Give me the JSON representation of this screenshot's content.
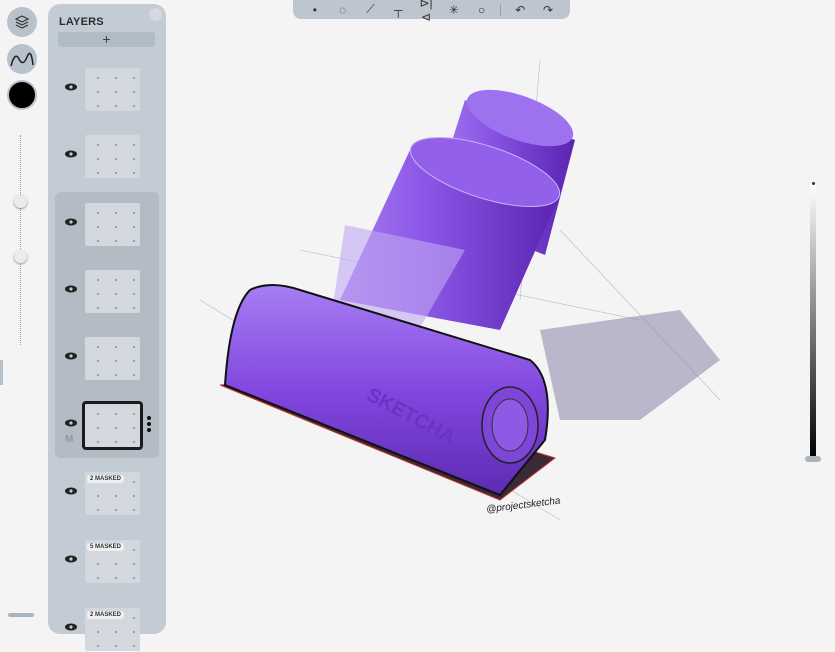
{
  "layers_panel": {
    "title": "LAYERS",
    "add_label": "+",
    "layers": [
      {
        "visible": true
      },
      {
        "visible": true
      },
      {
        "visible": true
      },
      {
        "visible": true
      },
      {
        "visible": true
      },
      {
        "visible": true,
        "selected": true,
        "mode_label": "M"
      },
      {
        "visible": true,
        "badge": "2 MASKED"
      },
      {
        "visible": true,
        "badge": "5 MASKED"
      },
      {
        "visible": true,
        "badge": "2 MASKED"
      }
    ]
  },
  "toolbar": {
    "icons": [
      "dot-icon",
      "lasso-icon",
      "curve-icon",
      "perspective-icon",
      "symmetry-icon",
      "radial-icon",
      "rotate-icon",
      "undo-icon",
      "redo-icon"
    ]
  },
  "canvas": {
    "signature": "@projectsketcha",
    "embossed_text": "SKETCHA",
    "object_color": "#8a4fe0"
  },
  "brush": {
    "color": "#000000",
    "opacity": 1.0
  }
}
